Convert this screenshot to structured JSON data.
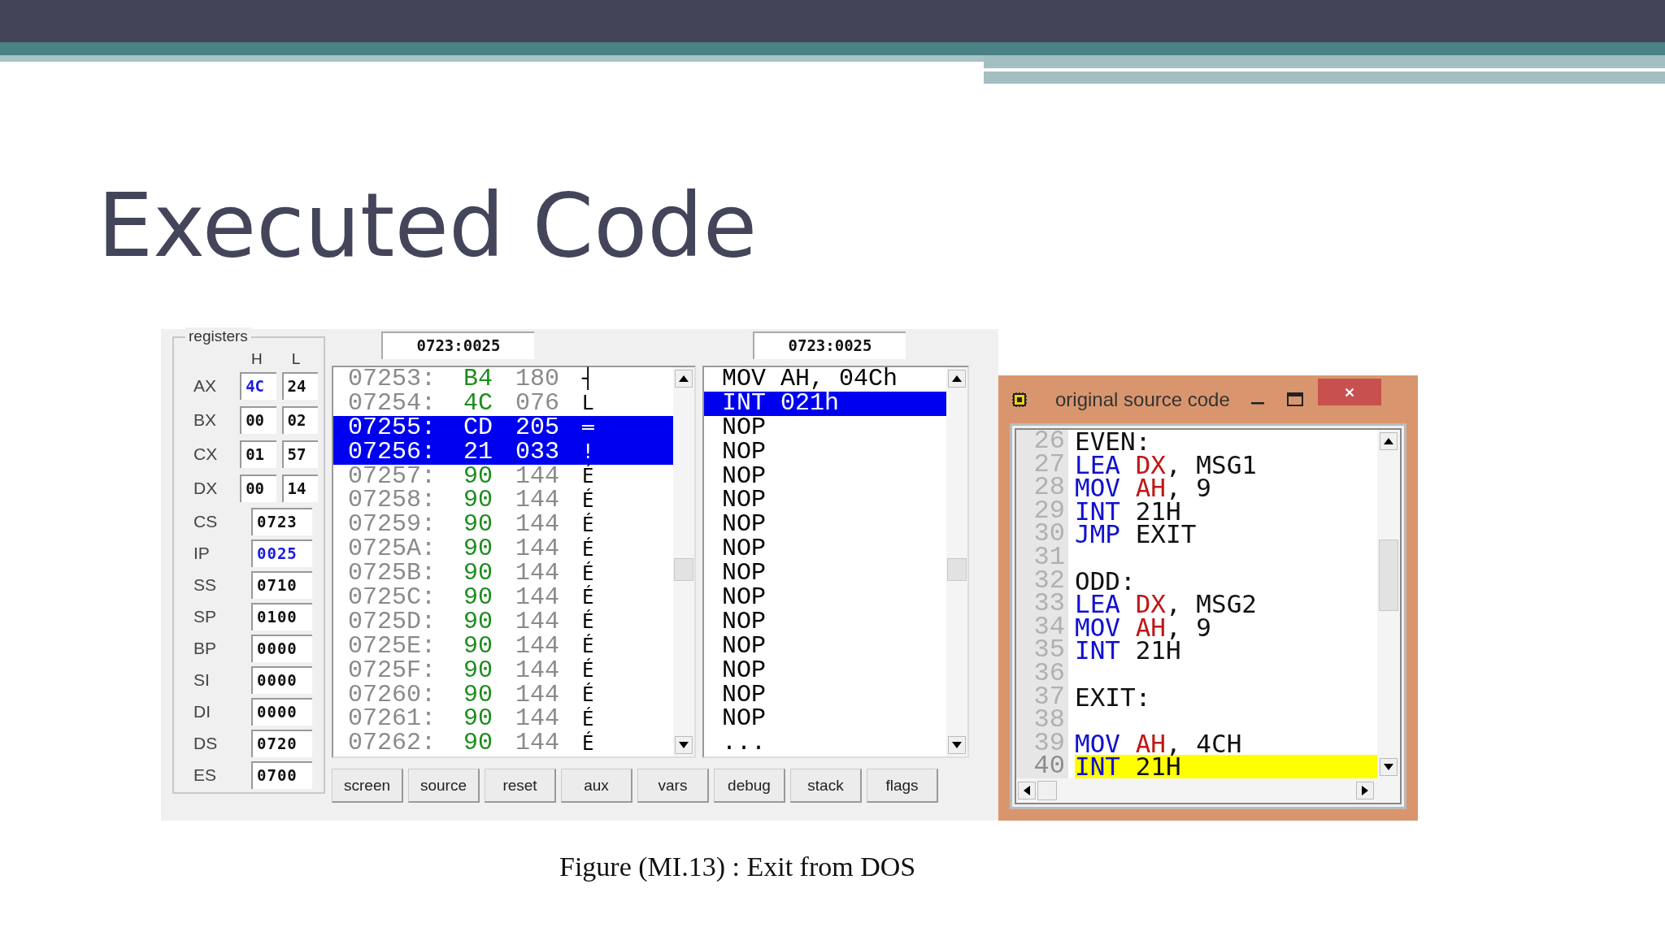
{
  "slide": {
    "title": "Executed Code",
    "caption": "Figure (MI.13) : Exit from DOS"
  },
  "registers": {
    "label": "registers",
    "high_header": "H",
    "low_header": "L",
    "pairs": [
      {
        "name": "AX",
        "high": "4C",
        "high_changed": true,
        "low": "24",
        "low_changed": false
      },
      {
        "name": "BX",
        "high": "00",
        "high_changed": false,
        "low": "02",
        "low_changed": false
      },
      {
        "name": "CX",
        "high": "01",
        "high_changed": false,
        "low": "57",
        "low_changed": false
      },
      {
        "name": "DX",
        "high": "00",
        "high_changed": false,
        "low": "14",
        "low_changed": false
      }
    ],
    "words": [
      {
        "name": "CS",
        "value": "0723",
        "changed": false
      },
      {
        "name": "IP",
        "value": "0025",
        "changed": true
      },
      {
        "name": "SS",
        "value": "0710",
        "changed": false
      },
      {
        "name": "SP",
        "value": "0100",
        "changed": false
      },
      {
        "name": "BP",
        "value": "0000",
        "changed": false
      },
      {
        "name": "SI",
        "value": "0000",
        "changed": false
      },
      {
        "name": "DI",
        "value": "0000",
        "changed": false
      },
      {
        "name": "DS",
        "value": "0720",
        "changed": false
      },
      {
        "name": "ES",
        "value": "0700",
        "changed": false
      }
    ]
  },
  "memory": {
    "address": "0723:0025",
    "rows": [
      {
        "address": "07253:",
        "hex": "B4",
        "dec": "180",
        "char": "┤",
        "selected": false
      },
      {
        "address": "07254:",
        "hex": "4C",
        "dec": "076",
        "char": "L",
        "selected": false
      },
      {
        "address": "07255:",
        "hex": "CD",
        "dec": "205",
        "char": "═",
        "selected": true
      },
      {
        "address": "07256:",
        "hex": "21",
        "dec": "033",
        "char": "!",
        "selected": true
      },
      {
        "address": "07257:",
        "hex": "90",
        "dec": "144",
        "char": "É",
        "selected": false
      },
      {
        "address": "07258:",
        "hex": "90",
        "dec": "144",
        "char": "É",
        "selected": false
      },
      {
        "address": "07259:",
        "hex": "90",
        "dec": "144",
        "char": "É",
        "selected": false
      },
      {
        "address": "0725A:",
        "hex": "90",
        "dec": "144",
        "char": "É",
        "selected": false
      },
      {
        "address": "0725B:",
        "hex": "90",
        "dec": "144",
        "char": "É",
        "selected": false
      },
      {
        "address": "0725C:",
        "hex": "90",
        "dec": "144",
        "char": "É",
        "selected": false
      },
      {
        "address": "0725D:",
        "hex": "90",
        "dec": "144",
        "char": "É",
        "selected": false
      },
      {
        "address": "0725E:",
        "hex": "90",
        "dec": "144",
        "char": "É",
        "selected": false
      },
      {
        "address": "0725F:",
        "hex": "90",
        "dec": "144",
        "char": "É",
        "selected": false
      },
      {
        "address": "07260:",
        "hex": "90",
        "dec": "144",
        "char": "É",
        "selected": false
      },
      {
        "address": "07261:",
        "hex": "90",
        "dec": "144",
        "char": "É",
        "selected": false
      },
      {
        "address": "07262:",
        "hex": "90",
        "dec": "144",
        "char": "É",
        "selected": false
      }
    ]
  },
  "disassembly": {
    "address": "0723:0025",
    "lines": [
      {
        "text": "MOV AH, 04Ch",
        "selected": false
      },
      {
        "text": "INT 021h",
        "selected": true
      },
      {
        "text": "NOP",
        "selected": false
      },
      {
        "text": "NOP",
        "selected": false
      },
      {
        "text": "NOP",
        "selected": false
      },
      {
        "text": "NOP",
        "selected": false
      },
      {
        "text": "NOP",
        "selected": false
      },
      {
        "text": "NOP",
        "selected": false
      },
      {
        "text": "NOP",
        "selected": false
      },
      {
        "text": "NOP",
        "selected": false
      },
      {
        "text": "NOP",
        "selected": false
      },
      {
        "text": "NOP",
        "selected": false
      },
      {
        "text": "NOP",
        "selected": false
      },
      {
        "text": "NOP",
        "selected": false
      },
      {
        "text": "NOP",
        "selected": false
      },
      {
        "text": "...",
        "selected": false
      }
    ]
  },
  "buttons": [
    "screen",
    "source",
    "reset",
    "aux",
    "vars",
    "debug",
    "stack",
    "flags"
  ],
  "source_window": {
    "title": "original source code",
    "lines": [
      {
        "number": "26",
        "current": false,
        "tokens": [
          {
            "text": "EVEN:",
            "kind": "plain"
          }
        ]
      },
      {
        "number": "27",
        "current": false,
        "tokens": [
          {
            "text": "LEA ",
            "kind": "keyword"
          },
          {
            "text": "DX",
            "kind": "register"
          },
          {
            "text": ", MSG1",
            "kind": "plain"
          }
        ]
      },
      {
        "number": "28",
        "current": false,
        "tokens": [
          {
            "text": "MOV ",
            "kind": "keyword"
          },
          {
            "text": "AH",
            "kind": "register"
          },
          {
            "text": ", 9",
            "kind": "plain"
          }
        ]
      },
      {
        "number": "29",
        "current": false,
        "tokens": [
          {
            "text": "INT ",
            "kind": "keyword"
          },
          {
            "text": "21H",
            "kind": "plain"
          }
        ]
      },
      {
        "number": "30",
        "current": false,
        "tokens": [
          {
            "text": "JMP ",
            "kind": "keyword"
          },
          {
            "text": "EXIT",
            "kind": "plain"
          }
        ]
      },
      {
        "number": "31",
        "current": false
      },
      {
        "number": "32",
        "current": false,
        "tokens": [
          {
            "text": "ODD:",
            "kind": "plain"
          }
        ]
      },
      {
        "number": "33",
        "current": false,
        "tokens": [
          {
            "text": "LEA ",
            "kind": "keyword"
          },
          {
            "text": "DX",
            "kind": "register"
          },
          {
            "text": ", MSG2",
            "kind": "plain"
          }
        ]
      },
      {
        "number": "34",
        "current": false,
        "tokens": [
          {
            "text": "MOV ",
            "kind": "keyword"
          },
          {
            "text": "AH",
            "kind": "register"
          },
          {
            "text": ", 9",
            "kind": "plain"
          }
        ]
      },
      {
        "number": "35",
        "current": false,
        "tokens": [
          {
            "text": "INT ",
            "kind": "keyword"
          },
          {
            "text": "21H",
            "kind": "plain"
          }
        ]
      },
      {
        "number": "36",
        "current": false
      },
      {
        "number": "37",
        "current": false,
        "tokens": [
          {
            "text": "EXIT:",
            "kind": "plain"
          }
        ]
      },
      {
        "number": "38",
        "current": false
      },
      {
        "number": "39",
        "current": false,
        "tokens": [
          {
            "text": "MOV ",
            "kind": "keyword"
          },
          {
            "text": "AH",
            "kind": "register"
          },
          {
            "text": ", 4CH",
            "kind": "plain"
          }
        ]
      },
      {
        "number": "40",
        "current": true,
        "tokens": [
          {
            "text": "INT ",
            "kind": "keyword"
          },
          {
            "text": "21H",
            "kind": "plain"
          }
        ]
      }
    ]
  }
}
